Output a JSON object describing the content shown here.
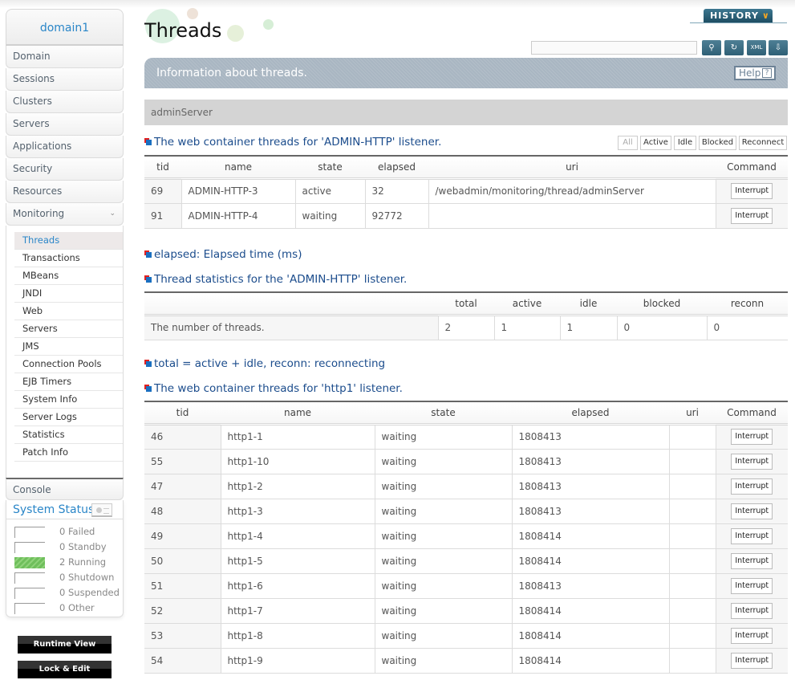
{
  "sidebar": {
    "domain": "domain1",
    "nav": [
      "Domain",
      "Sessions",
      "Clusters",
      "Servers",
      "Applications",
      "Security",
      "Resources",
      "Monitoring"
    ],
    "monitoring_items": [
      "Threads",
      "Transactions",
      "MBeans",
      "JNDI",
      "Web",
      "Servers",
      "JMS",
      "Connection Pools",
      "EJB Timers",
      "System Info",
      "Server Logs",
      "Statistics",
      "Patch Info"
    ],
    "active_item": "Threads",
    "console": "Console",
    "system_status": {
      "title": "System Status",
      "rows": [
        {
          "count": "0",
          "label": "Failed"
        },
        {
          "count": "0",
          "label": "Standby"
        },
        {
          "count": "2",
          "label": "Running"
        },
        {
          "count": "0",
          "label": "Shutdown"
        },
        {
          "count": "0",
          "label": "Suspended"
        },
        {
          "count": "0",
          "label": "Other"
        }
      ]
    },
    "runtime_view": "Runtime View",
    "lock_edit": "Lock & Edit"
  },
  "header": {
    "title": "Threads",
    "history": "HISTORY",
    "search_value": "",
    "info": "Information about threads.",
    "help": "Help",
    "server": "adminServer"
  },
  "admin_http": {
    "title": "The web container threads for 'ADMIN-HTTP' listener.",
    "filters": [
      "All",
      "Active",
      "Idle",
      "Blocked",
      "Reconnect"
    ],
    "columns": [
      "tid",
      "name",
      "state",
      "elapsed",
      "uri",
      "Command"
    ],
    "rows": [
      {
        "tid": "69",
        "name": "ADMIN-HTTP-3",
        "state": "active",
        "elapsed": "32",
        "uri": "/webadmin/monitoring/thread/adminServer",
        "command": "Interrupt"
      },
      {
        "tid": "91",
        "name": "ADMIN-HTTP-4",
        "state": "waiting",
        "elapsed": "92772",
        "uri": "",
        "command": "Interrupt"
      }
    ]
  },
  "elapsed_note": "elapsed: Elapsed time (ms)",
  "stats": {
    "title": "Thread statistics for the 'ADMIN-HTTP' listener.",
    "columns": [
      "",
      "total",
      "active",
      "idle",
      "blocked",
      "reconn"
    ],
    "row": {
      "label": "The number of threads.",
      "total": "2",
      "active": "1",
      "idle": "1",
      "blocked": "0",
      "reconn": "0"
    }
  },
  "total_note": "total = active + idle, reconn: reconnecting",
  "http1": {
    "title": "The web container threads for 'http1' listener.",
    "columns": [
      "tid",
      "name",
      "state",
      "elapsed",
      "uri",
      "Command"
    ],
    "rows": [
      {
        "tid": "46",
        "name": "http1-1",
        "state": "waiting",
        "elapsed": "1808413",
        "uri": "",
        "command": "Interrupt"
      },
      {
        "tid": "55",
        "name": "http1-10",
        "state": "waiting",
        "elapsed": "1808413",
        "uri": "",
        "command": "Interrupt"
      },
      {
        "tid": "47",
        "name": "http1-2",
        "state": "waiting",
        "elapsed": "1808413",
        "uri": "",
        "command": "Interrupt"
      },
      {
        "tid": "48",
        "name": "http1-3",
        "state": "waiting",
        "elapsed": "1808413",
        "uri": "",
        "command": "Interrupt"
      },
      {
        "tid": "49",
        "name": "http1-4",
        "state": "waiting",
        "elapsed": "1808414",
        "uri": "",
        "command": "Interrupt"
      },
      {
        "tid": "50",
        "name": "http1-5",
        "state": "waiting",
        "elapsed": "1808414",
        "uri": "",
        "command": "Interrupt"
      },
      {
        "tid": "51",
        "name": "http1-6",
        "state": "waiting",
        "elapsed": "1808413",
        "uri": "",
        "command": "Interrupt"
      },
      {
        "tid": "52",
        "name": "http1-7",
        "state": "waiting",
        "elapsed": "1808414",
        "uri": "",
        "command": "Interrupt"
      },
      {
        "tid": "53",
        "name": "http1-8",
        "state": "waiting",
        "elapsed": "1808414",
        "uri": "",
        "command": "Interrupt"
      },
      {
        "tid": "54",
        "name": "http1-9",
        "state": "waiting",
        "elapsed": "1808414",
        "uri": "",
        "command": "Interrupt"
      }
    ]
  }
}
